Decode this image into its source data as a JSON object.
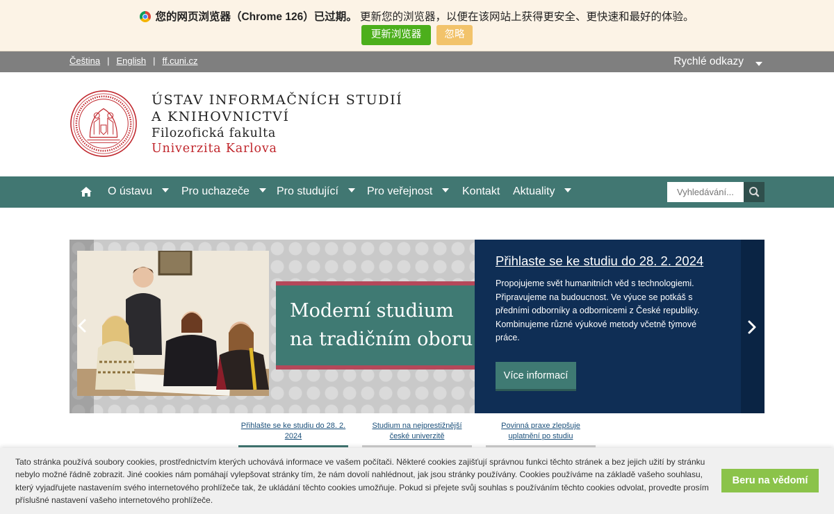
{
  "browser_update": {
    "title": "您的网页浏览器（Chrome 126）已过期。",
    "message": "更新您的浏览器，以便在该网站上获得更安全、更快速和最好的体验。",
    "update_label": "更新浏览器",
    "ignore_label": "忽略"
  },
  "top_bar": {
    "languages": [
      "Čeština",
      "English",
      "ff.cuni.cz"
    ],
    "quick_links": "Rychlé odkazy"
  },
  "header": {
    "line1": "ÚSTAV INFORMAČNÍCH STUDIÍ",
    "line2": "A KNIHOVNICTVÍ",
    "faculty": "Filozofická fakulta",
    "university": "Univerzita Karlova"
  },
  "nav": {
    "items": [
      {
        "label": "O ústavu",
        "dropdown": true
      },
      {
        "label": "Pro uchazeče",
        "dropdown": true
      },
      {
        "label": "Pro studující",
        "dropdown": true
      },
      {
        "label": "Pro veřejnost",
        "dropdown": true
      },
      {
        "label": "Kontakt",
        "dropdown": false
      },
      {
        "label": "Aktuality",
        "dropdown": true
      }
    ],
    "search_placeholder": "Vyhledávání..."
  },
  "carousel": {
    "slogan_line1": "Moderní studium",
    "slogan_line2": "na tradičním oboru",
    "slide_title": "Přihlaste se ke studiu do 28. 2. 2024",
    "slide_description": "Propojujeme svět humanitních věd s technologiemi. Připravujeme na budoucnost. Ve výuce se potkáš s předními odborníky a odbornicemi z České republiky. Kombinujeme různé výukové metody včetně týmové práce.",
    "more_label": "Více informací",
    "indicators": [
      {
        "label": "Přihlašte se ke studiu do 28. 2. 2024",
        "active": true
      },
      {
        "label": "Studium na nejprestižnější české univerzitě",
        "active": false
      },
      {
        "label": "Povinná praxe zlepšuje uplatnění po studiu",
        "active": false
      }
    ]
  },
  "cookie": {
    "text": "Tato stránka používá soubory cookies, prostřednictvím kterých uchovává informace ve vašem počítači. Některé cookies zajišťují správnou funkci těchto stránek a bez jejich užití by stránku nebylo možné řádně zobrazit. Jiné cookies nám pomáhají vylepšovat stránky tím, že nám dovolí nahlédnout, jak jsou stránky používány. Cookies používáme na základě vašeho souhlasu, který vyjadřujete nastavením svého internetového prohlížeče tak, že ukládání těchto cookies umožňuje. Pokud si přejete svůj souhlas s používáním těchto cookies odvolat, provedte prosím příslušné nastavení vašeho internetového prohlížeče.",
    "accept_label": "Beru na vědomí"
  },
  "colors": {
    "nav": "#417772",
    "banner": "#fcf3e6",
    "slide_panel": "#0f2e55",
    "accent_red": "#c0262c",
    "update_green": "#4caf1c",
    "ignore_yellow": "#f2c36b",
    "cookie_green": "#8bc34a"
  }
}
